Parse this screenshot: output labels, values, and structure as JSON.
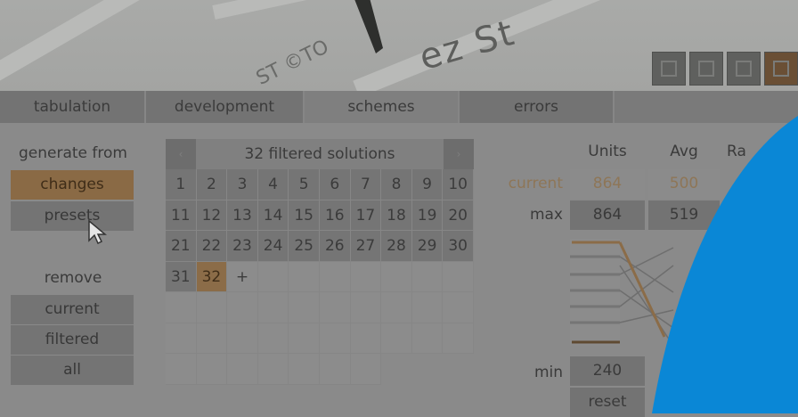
{
  "map": {
    "street_label": "ez St",
    "street_label_2": "ST ©TO"
  },
  "tabs": [
    {
      "label": "tabulation"
    },
    {
      "label": "development"
    },
    {
      "label": "schemes"
    },
    {
      "label": "errors"
    }
  ],
  "left": {
    "generate_from": "generate from",
    "changes": "changes",
    "presets": "presets",
    "remove": "remove",
    "current": "current",
    "filtered": "filtered",
    "all": "all"
  },
  "grid": {
    "title": "32 filtered solutions",
    "prev": "‹",
    "next": "›",
    "solutions": [
      "1",
      "2",
      "3",
      "4",
      "5",
      "6",
      "7",
      "8",
      "9",
      "10",
      "11",
      "12",
      "13",
      "14",
      "15",
      "16",
      "17",
      "18",
      "19",
      "20",
      "21",
      "22",
      "23",
      "24",
      "25",
      "26",
      "27",
      "28",
      "29",
      "30",
      "31",
      "32"
    ],
    "selected": "32",
    "add": "+"
  },
  "stats": {
    "headers": [
      "Units",
      "Avg",
      "Ra"
    ],
    "current_label": "current",
    "max_label": "max",
    "min_label": "min",
    "current": {
      "units": "864",
      "avg": "500"
    },
    "max": {
      "units": "864",
      "avg": "519"
    },
    "min": {
      "units": "240"
    },
    "reset": "reset"
  },
  "colors": {
    "accent_orange": "#8b6c48",
    "overlay_blue": "#0a87d6"
  }
}
